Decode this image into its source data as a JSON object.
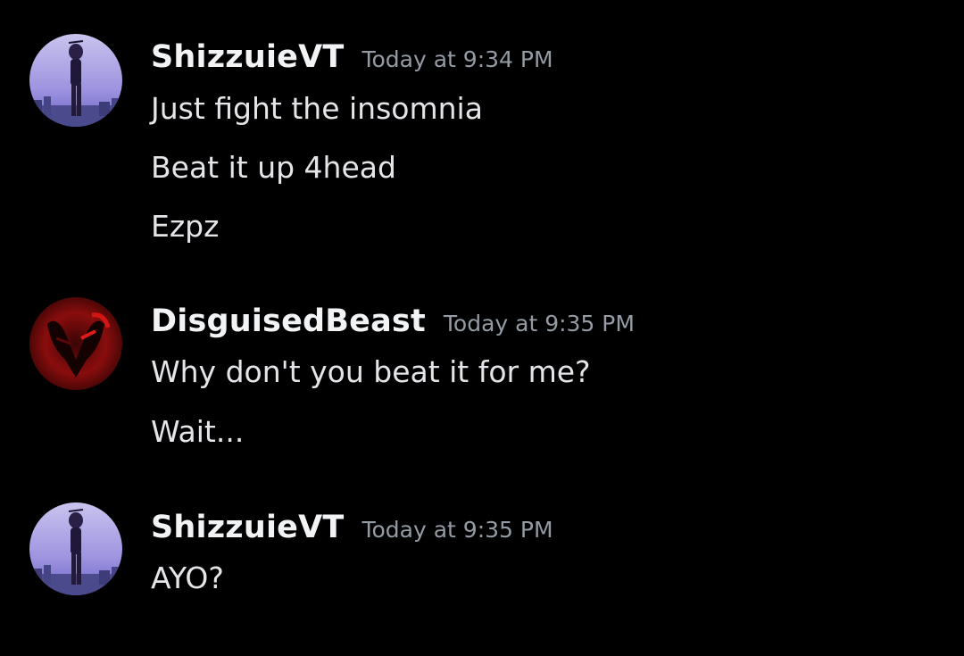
{
  "colors": {
    "background": "#000000",
    "username": "#f2f3f5",
    "timestamp": "#949ba4",
    "message_text": "#e3e5e8"
  },
  "messages": [
    {
      "author": "ShizzuieVT",
      "timestamp": "Today at 9:34 PM",
      "avatar_icon": "anime-character-avatar-icon",
      "lines": [
        "Just fight the insomnia",
        "Beat it up 4head",
        "Ezpz"
      ]
    },
    {
      "author": "DisguisedBeast",
      "timestamp": "Today at 9:35 PM",
      "avatar_icon": "red-demon-mask-avatar-icon",
      "lines": [
        "Why don't you beat it for me?",
        "Wait..."
      ]
    },
    {
      "author": "ShizzuieVT",
      "timestamp": "Today at 9:35 PM",
      "avatar_icon": "anime-character-avatar-icon",
      "lines": [
        "AYO?"
      ]
    }
  ]
}
